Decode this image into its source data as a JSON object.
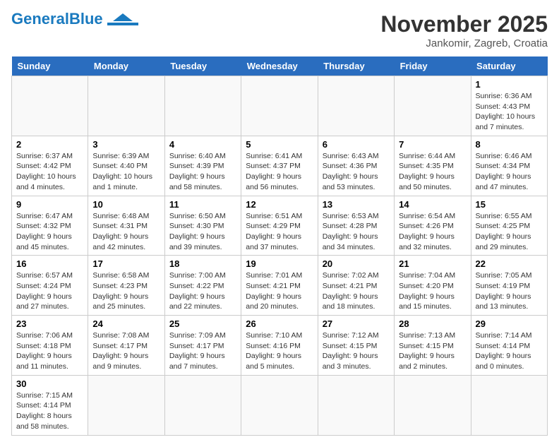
{
  "header": {
    "logo_general": "General",
    "logo_blue": "Blue",
    "month_title": "November 2025",
    "location": "Jankomir, Zagreb, Croatia"
  },
  "days_of_week": [
    "Sunday",
    "Monday",
    "Tuesday",
    "Wednesday",
    "Thursday",
    "Friday",
    "Saturday"
  ],
  "weeks": [
    [
      {
        "day": "",
        "info": ""
      },
      {
        "day": "",
        "info": ""
      },
      {
        "day": "",
        "info": ""
      },
      {
        "day": "",
        "info": ""
      },
      {
        "day": "",
        "info": ""
      },
      {
        "day": "",
        "info": ""
      },
      {
        "day": "1",
        "info": "Sunrise: 6:36 AM\nSunset: 4:43 PM\nDaylight: 10 hours and 7 minutes."
      }
    ],
    [
      {
        "day": "2",
        "info": "Sunrise: 6:37 AM\nSunset: 4:42 PM\nDaylight: 10 hours and 4 minutes."
      },
      {
        "day": "3",
        "info": "Sunrise: 6:39 AM\nSunset: 4:40 PM\nDaylight: 10 hours and 1 minute."
      },
      {
        "day": "4",
        "info": "Sunrise: 6:40 AM\nSunset: 4:39 PM\nDaylight: 9 hours and 58 minutes."
      },
      {
        "day": "5",
        "info": "Sunrise: 6:41 AM\nSunset: 4:37 PM\nDaylight: 9 hours and 56 minutes."
      },
      {
        "day": "6",
        "info": "Sunrise: 6:43 AM\nSunset: 4:36 PM\nDaylight: 9 hours and 53 minutes."
      },
      {
        "day": "7",
        "info": "Sunrise: 6:44 AM\nSunset: 4:35 PM\nDaylight: 9 hours and 50 minutes."
      },
      {
        "day": "8",
        "info": "Sunrise: 6:46 AM\nSunset: 4:34 PM\nDaylight: 9 hours and 47 minutes."
      }
    ],
    [
      {
        "day": "9",
        "info": "Sunrise: 6:47 AM\nSunset: 4:32 PM\nDaylight: 9 hours and 45 minutes."
      },
      {
        "day": "10",
        "info": "Sunrise: 6:48 AM\nSunset: 4:31 PM\nDaylight: 9 hours and 42 minutes."
      },
      {
        "day": "11",
        "info": "Sunrise: 6:50 AM\nSunset: 4:30 PM\nDaylight: 9 hours and 39 minutes."
      },
      {
        "day": "12",
        "info": "Sunrise: 6:51 AM\nSunset: 4:29 PM\nDaylight: 9 hours and 37 minutes."
      },
      {
        "day": "13",
        "info": "Sunrise: 6:53 AM\nSunset: 4:28 PM\nDaylight: 9 hours and 34 minutes."
      },
      {
        "day": "14",
        "info": "Sunrise: 6:54 AM\nSunset: 4:26 PM\nDaylight: 9 hours and 32 minutes."
      },
      {
        "day": "15",
        "info": "Sunrise: 6:55 AM\nSunset: 4:25 PM\nDaylight: 9 hours and 29 minutes."
      }
    ],
    [
      {
        "day": "16",
        "info": "Sunrise: 6:57 AM\nSunset: 4:24 PM\nDaylight: 9 hours and 27 minutes."
      },
      {
        "day": "17",
        "info": "Sunrise: 6:58 AM\nSunset: 4:23 PM\nDaylight: 9 hours and 25 minutes."
      },
      {
        "day": "18",
        "info": "Sunrise: 7:00 AM\nSunset: 4:22 PM\nDaylight: 9 hours and 22 minutes."
      },
      {
        "day": "19",
        "info": "Sunrise: 7:01 AM\nSunset: 4:21 PM\nDaylight: 9 hours and 20 minutes."
      },
      {
        "day": "20",
        "info": "Sunrise: 7:02 AM\nSunset: 4:21 PM\nDaylight: 9 hours and 18 minutes."
      },
      {
        "day": "21",
        "info": "Sunrise: 7:04 AM\nSunset: 4:20 PM\nDaylight: 9 hours and 15 minutes."
      },
      {
        "day": "22",
        "info": "Sunrise: 7:05 AM\nSunset: 4:19 PM\nDaylight: 9 hours and 13 minutes."
      }
    ],
    [
      {
        "day": "23",
        "info": "Sunrise: 7:06 AM\nSunset: 4:18 PM\nDaylight: 9 hours and 11 minutes."
      },
      {
        "day": "24",
        "info": "Sunrise: 7:08 AM\nSunset: 4:17 PM\nDaylight: 9 hours and 9 minutes."
      },
      {
        "day": "25",
        "info": "Sunrise: 7:09 AM\nSunset: 4:17 PM\nDaylight: 9 hours and 7 minutes."
      },
      {
        "day": "26",
        "info": "Sunrise: 7:10 AM\nSunset: 4:16 PM\nDaylight: 9 hours and 5 minutes."
      },
      {
        "day": "27",
        "info": "Sunrise: 7:12 AM\nSunset: 4:15 PM\nDaylight: 9 hours and 3 minutes."
      },
      {
        "day": "28",
        "info": "Sunrise: 7:13 AM\nSunset: 4:15 PM\nDaylight: 9 hours and 2 minutes."
      },
      {
        "day": "29",
        "info": "Sunrise: 7:14 AM\nSunset: 4:14 PM\nDaylight: 9 hours and 0 minutes."
      }
    ],
    [
      {
        "day": "30",
        "info": "Sunrise: 7:15 AM\nSunset: 4:14 PM\nDaylight: 8 hours and 58 minutes."
      },
      {
        "day": "",
        "info": ""
      },
      {
        "day": "",
        "info": ""
      },
      {
        "day": "",
        "info": ""
      },
      {
        "day": "",
        "info": ""
      },
      {
        "day": "",
        "info": ""
      },
      {
        "day": "",
        "info": ""
      }
    ]
  ]
}
